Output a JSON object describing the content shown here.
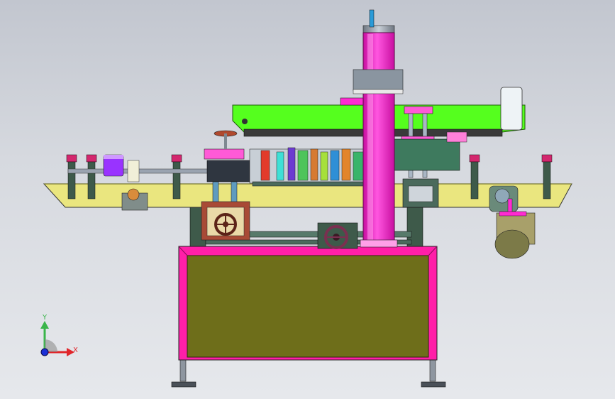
{
  "triad": {
    "y_label": "Y",
    "x_label": "X",
    "y_color": "#3ab54a",
    "x_color": "#e0262b",
    "z_color": "#1b2fd6"
  },
  "colors": {
    "background_top": "#c2c6cf",
    "background_bottom": "#e6e8ec",
    "cabinet_frame": "#ff1fa8",
    "cabinet_panel": "#6e6e1a",
    "table_plate": "#eae67f",
    "head_green": "#55ff1e",
    "column_magenta": "#ff2bd1",
    "bracket_dark": "#3e5a4a",
    "steel": "#9aa3b0"
  }
}
